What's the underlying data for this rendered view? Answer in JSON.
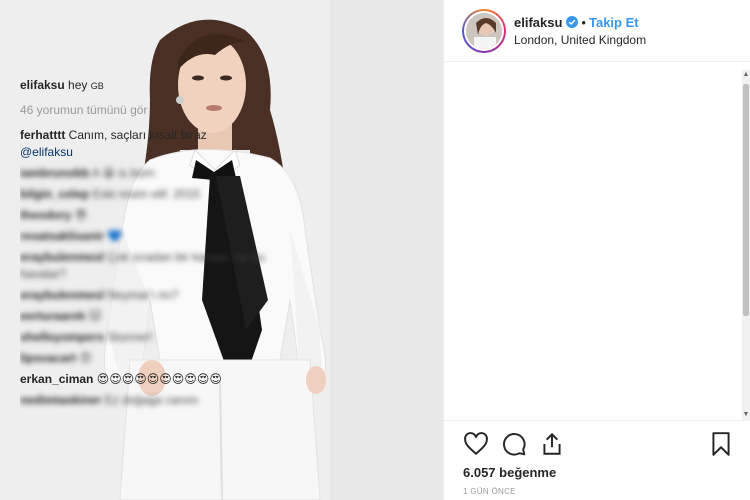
{
  "post": {
    "username": "elifaksu",
    "separator": "•",
    "follow_label": "Takip Et",
    "location": "London, United Kingdom",
    "caption_user": "elifaksu",
    "caption_text": "hey",
    "caption_suffix": "GB",
    "view_all": "46 yorumun tümünü gör",
    "likes": "6.057 beğenme",
    "time": "1 GÜN ÖNCE"
  },
  "comments": [
    {
      "user": "ferhatttt",
      "text": "Canım, saçları kısalt biraz",
      "mention": "@elifaksu",
      "blurred": false
    },
    {
      "user": "iambrunobb",
      "text": "A 😀 is born",
      "blurred": true
    },
    {
      "user": "bilgin_celep",
      "text": "Eski resim elif. 2015",
      "blurred": true
    },
    {
      "user": "theodory",
      "text": "😎",
      "blurred": true
    },
    {
      "user": "resatsaklisanir",
      "text": "💙",
      "blurred": true
    },
    {
      "user": "eraybulenmesl",
      "text": "Çok sıradan bir karson, ne bu havalar?",
      "blurred": true
    },
    {
      "user": "eraybulenmesl",
      "text": "Neymar'ı mı?",
      "blurred": true
    },
    {
      "user": "eerturaarek",
      "text": "🐱",
      "blurred": true
    },
    {
      "user": "shelleyompers",
      "text": "Stunner!",
      "blurred": true
    },
    {
      "user": "lipsvacart",
      "text": "😍",
      "blurred": true
    },
    {
      "user": "erkan_ciman",
      "text": "😍😍😍😍😍😍😍😍😍😍",
      "blurred": true
    },
    {
      "user": "nedimtaskiner",
      "text": "Ez doğaga canım",
      "blurred": true
    }
  ],
  "colors": {
    "accent": "#3897f0",
    "verified": "#3897f0",
    "text": "#262626",
    "muted": "#999999"
  },
  "icons": [
    "heart-icon",
    "comment-icon",
    "share-icon",
    "bookmark-icon",
    "verified-badge-icon"
  ]
}
